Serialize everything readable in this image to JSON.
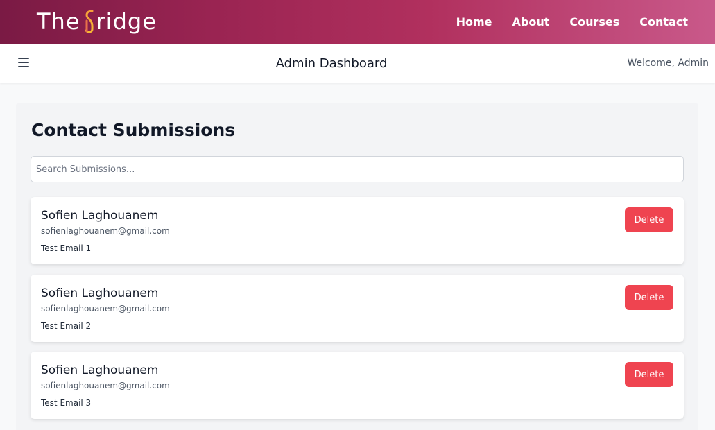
{
  "brand": {
    "logo_prefix": "The",
    "logo_suffix": "ridge",
    "gradient_start": "#7a1a44",
    "gradient_end": "#c9598a"
  },
  "nav": {
    "items": [
      {
        "label": "Home"
      },
      {
        "label": "About"
      },
      {
        "label": "Courses"
      },
      {
        "label": "Contact"
      }
    ]
  },
  "admin_bar": {
    "menu_icon": "hamburger-menu-icon",
    "title": "Admin Dashboard",
    "welcome": "Welcome, Admin"
  },
  "main": {
    "heading": "Contact Submissions",
    "search": {
      "placeholder": "Search Submissions...",
      "value": ""
    },
    "submissions": [
      {
        "name": "Sofien Laghouanem",
        "email": "sofienlaghouanem@gmail.com",
        "message": "Test Email 1",
        "delete_label": "Delete"
      },
      {
        "name": "Sofien Laghouanem",
        "email": "sofienlaghouanem@gmail.com",
        "message": "Test Email 2",
        "delete_label": "Delete"
      },
      {
        "name": "Sofien Laghouanem",
        "email": "sofienlaghouanem@gmail.com",
        "message": "Test Email 3",
        "delete_label": "Delete"
      }
    ]
  },
  "colors": {
    "delete_button": "#ef4450",
    "panel_bg": "#f3f4f6"
  }
}
